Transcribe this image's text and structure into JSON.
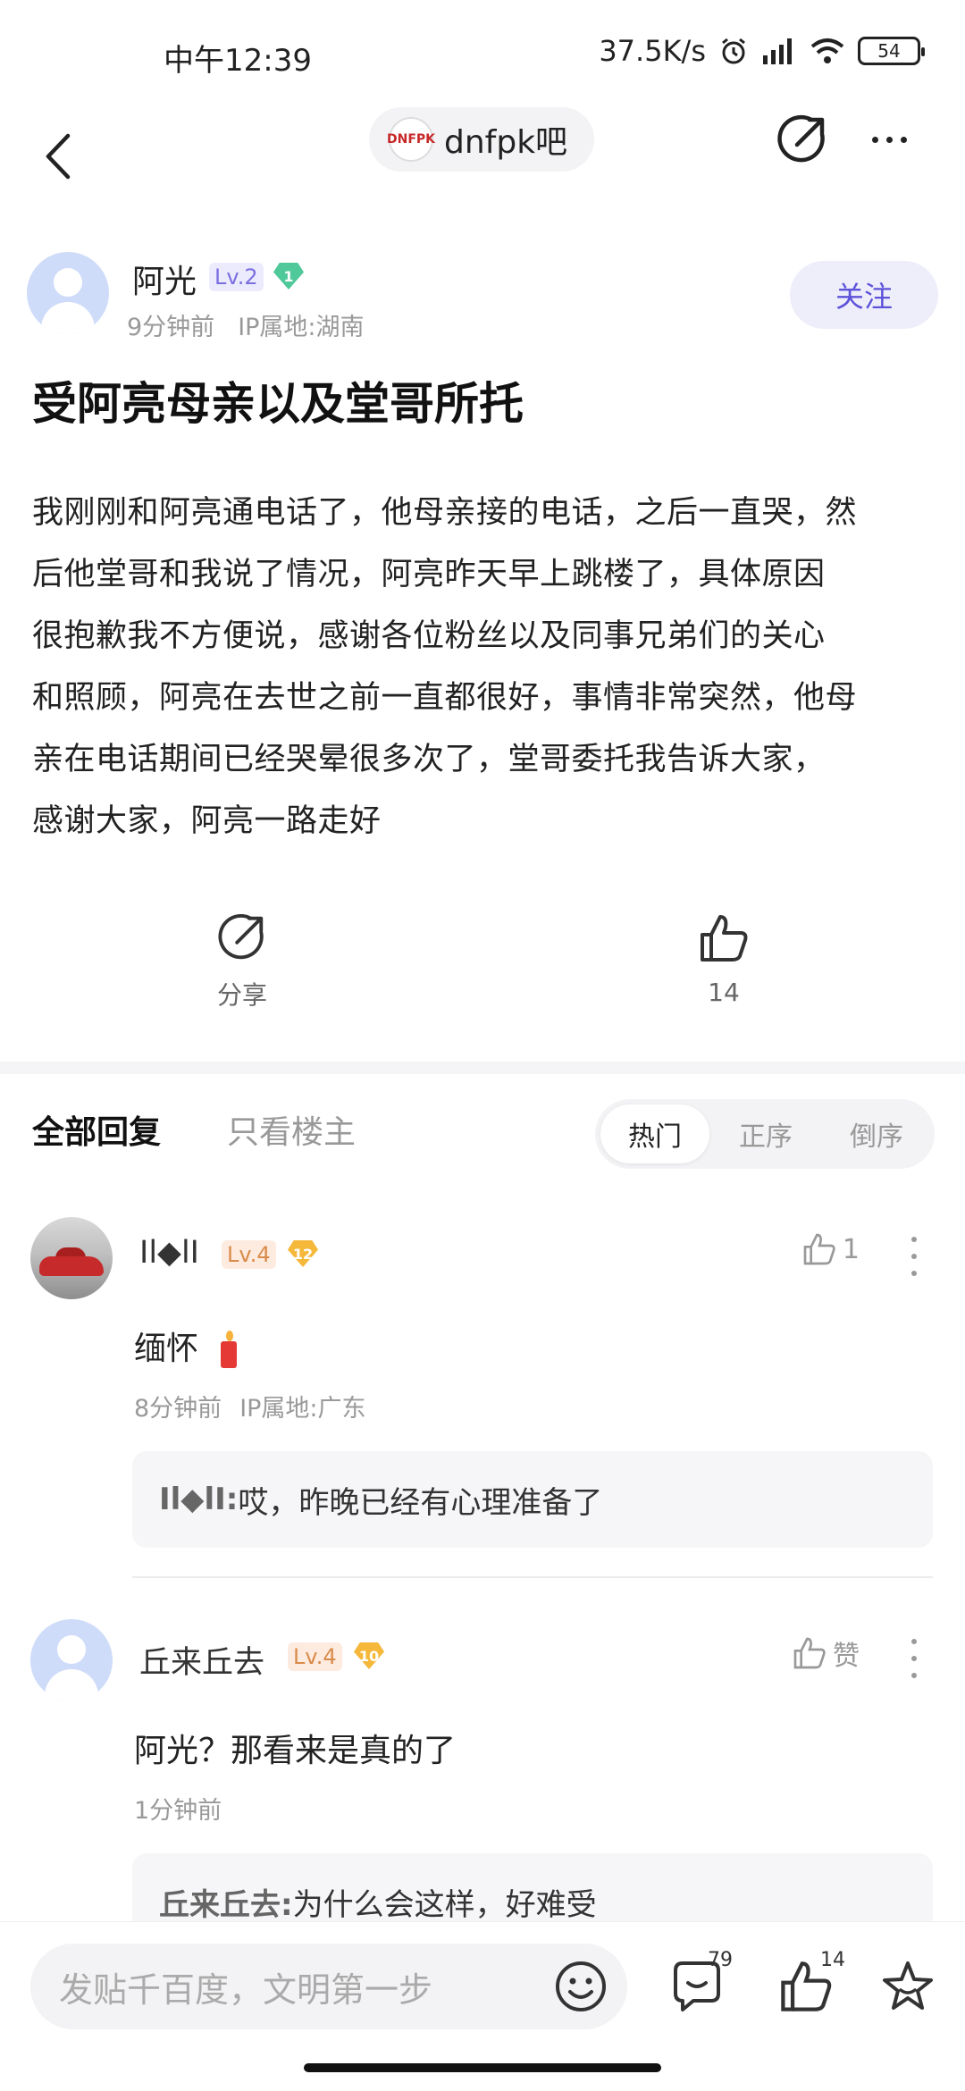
{
  "status_bar": {
    "time": "中午12:39",
    "network_speed": "37.5K/s",
    "battery": "54"
  },
  "nav": {
    "forum_name": "dnfpk吧",
    "forum_logo_text": "DNFPK"
  },
  "author": {
    "name": "阿光",
    "level": "Lv.2",
    "badge_number": "1",
    "time": "9分钟前",
    "ip": "IP属地:湖南",
    "follow_label": "关注"
  },
  "post": {
    "title": "受阿亮母亲以及堂哥所托",
    "body_lines": [
      "我刚刚和阿亮通电话了，他母亲接的电话，之后一直哭，然",
      "后他堂哥和我说了情况，阿亮昨天早上跳楼了，具体原因",
      "很抱歉我不方便说，感谢各位粉丝以及同事兄弟们的关心",
      "和照顾，阿亮在去世之前一直都很好，事情非常突然，他母",
      "亲在电话期间已经哭晕很多次了，堂哥委托我告诉大家，",
      "感谢大家，阿亮一路走好"
    ]
  },
  "post_actions": {
    "share_label": "分享",
    "like_count": "14"
  },
  "reply_tabs": {
    "all": "全部回复",
    "op_only": "只看楼主",
    "sort": [
      "热门",
      "正序",
      "倒序"
    ],
    "active_sort": "热门"
  },
  "comments": [
    {
      "name": "Il◆lI",
      "level": "Lv.4",
      "badge_number": "12",
      "like_label": "1",
      "text": "缅怀",
      "emoji": "🕯️",
      "time": "8分钟前",
      "ip": "IP属地:广东",
      "reply": {
        "name": "Il◆lI:",
        "text": " 哎，昨晚已经有心理准备了"
      }
    },
    {
      "name": "丘来丘去",
      "level": "Lv.4",
      "badge_number": "10",
      "like_label": "赞",
      "text": "阿光？那看来是真的了",
      "time": "1分钟前",
      "reply": {
        "name": "丘来丘去:",
        "text": " 为什么会这样，好难受"
      }
    }
  ],
  "bottom_bar": {
    "input_placeholder": "发贴千百度，文明第一步",
    "comment_count": "79",
    "like_count": "14"
  },
  "colors": {
    "accent": "#5d52d9",
    "follow_bg": "#eeeefb",
    "level_purple": "#7b6fe0",
    "level_orange": "#d98b4a"
  }
}
